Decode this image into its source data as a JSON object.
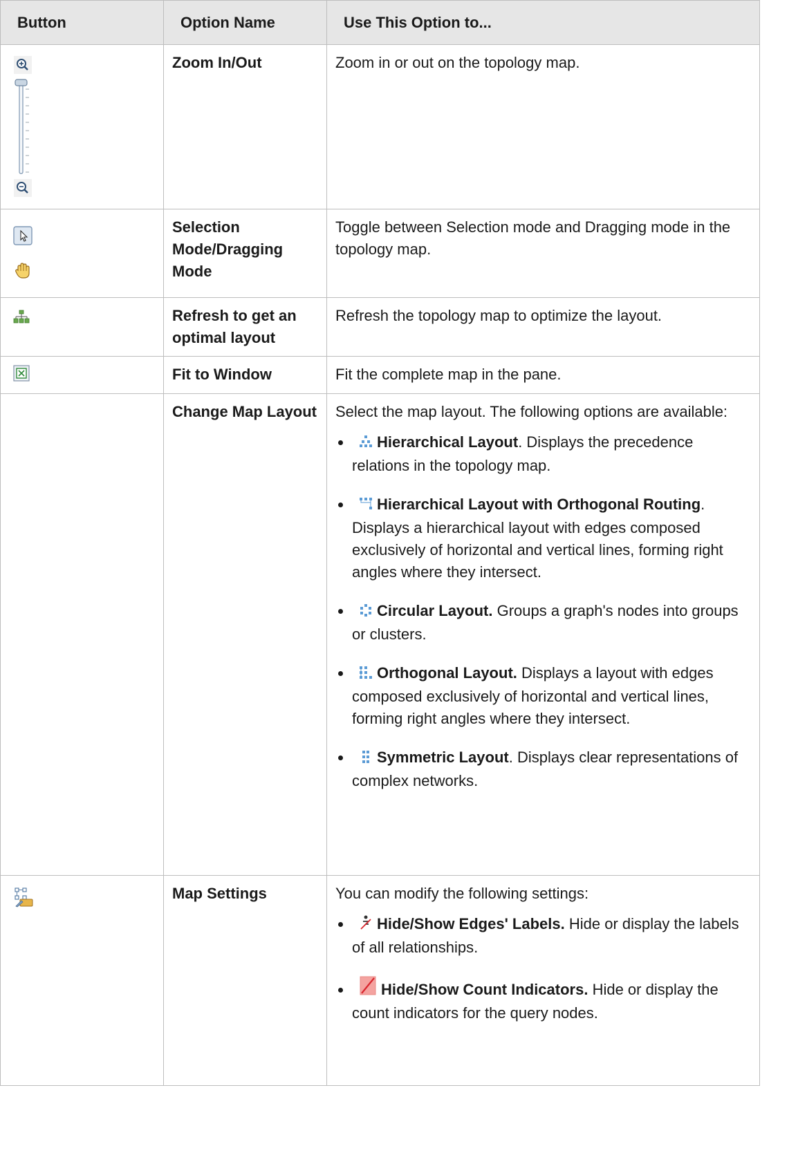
{
  "table": {
    "headers": [
      "Button",
      "Option Name",
      "Use This Option to..."
    ],
    "rows": [
      {
        "option": "Zoom In/Out",
        "desc": "Zoom in or out on the topology map.",
        "icons": [
          "zoom-in-icon",
          "zoom-slider",
          "zoom-out-icon"
        ]
      },
      {
        "option": "Selection Mode/Dragging Mode",
        "desc": "Toggle between Selection mode and Dragging mode in the topology map.",
        "icons": [
          "selection-pointer-icon",
          "hand-drag-icon"
        ]
      },
      {
        "option": "Refresh to get an optimal layout",
        "desc": "Refresh the topology map to optimize the layout.",
        "icons": [
          "refresh-layout-icon"
        ]
      },
      {
        "option": "Fit to Window",
        "desc": "Fit the complete map in the pane.",
        "icons": [
          "fit-window-icon"
        ]
      },
      {
        "option": "Change Map Layout",
        "desc": "Select the map layout. The following options are available:",
        "items": [
          {
            "title": "Hierarchical Layout",
            "rest": ". Displays the precedence relations in the topology map.",
            "icon": "hierarchical-layout-icon"
          },
          {
            "title": "Hierarchical Layout with Orthogonal Routing",
            "rest": ". Displays a hierarchical layout with edges composed exclusively of horizontal and vertical lines, forming right angles where they intersect.",
            "icon": "orthogonal-routing-icon"
          },
          {
            "title": "Circular Layout.",
            "rest": " Groups a graph's nodes into groups or clusters.",
            "icon": "circular-layout-icon"
          },
          {
            "title": "Orthogonal Layout.",
            "rest": " Displays a layout with edges composed exclusively of horizontal and vertical lines, forming right angles where they intersect.",
            "icon": "orthogonal-layout-icon"
          },
          {
            "title": "Symmetric Layout",
            "rest": ". Displays clear representations of complex networks.",
            "icon": "symmetric-layout-icon"
          }
        ]
      },
      {
        "option": "Map Settings",
        "desc": "You can modify the following settings:",
        "icons": [
          "map-settings-icon"
        ],
        "items": [
          {
            "title": "Hide/Show Edges' Labels.",
            "rest": " Hide or display the labels of all relationships.",
            "icon": "edge-labels-icon"
          },
          {
            "title": "Hide/Show Count Indicators.",
            "rest": " Hide or display the count indicators for the query nodes.",
            "icon": "count-indicators-icon"
          }
        ]
      }
    ]
  }
}
